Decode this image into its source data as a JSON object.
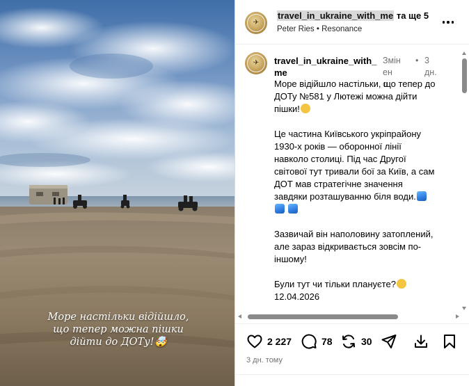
{
  "media": {
    "caption_lines": [
      "Море настільки відійшло,",
      "що тепер можна пішки",
      "дійти до ДОТу!🤯"
    ]
  },
  "header": {
    "username": "travel_in_ukraine_with_me",
    "and_more": "та ще 5",
    "audio_artist": "Peter Ries",
    "audio_separator": "•",
    "audio_title": "Resonance",
    "more_icon": "more-horizontal-icon"
  },
  "comment": {
    "username_line1": "travel_in_ukraine_with_",
    "username_line2": "me",
    "edited_line1": "Змінен",
    "edited_line2": "о",
    "dot": "•",
    "time_line1": "3",
    "time_line2": "дн.",
    "paragraphs": [
      {
        "lines": [
          "Море відійшло настільки, що тепер до",
          "ДОТу №581 у Лютежі можна дійти",
          "пішки!"
        ]
      },
      {
        "lines": [
          "Це частина Київського укріпрайону",
          "1930-х років — оборонної лінії",
          "навколо столиці. Під час Другої",
          "світової тут тривали бої за Київ, а сам",
          "ДОТ мав стратегічне значення",
          "завдяки розташуванню біля води."
        ]
      },
      {
        "lines": [
          "Зазвичай він наполовину затоплений,",
          "але зараз відкривається зовсім по-",
          "іншому!"
        ]
      },
      {
        "lines": [
          "Були тут чи тільки плануєте?",
          "12.04.2026"
        ]
      }
    ]
  },
  "actions": {
    "likes": "2 227",
    "comments": "78",
    "reposts": "30",
    "icons": [
      "heart-icon",
      "comment-icon",
      "repost-icon",
      "send-icon",
      "download-icon",
      "bookmark-icon"
    ]
  },
  "post_date": "3 дн. тому",
  "colors": {
    "text": "#000000",
    "muted": "#737373",
    "border": "#dbdbdb",
    "scrollbar": "#8a8a8a"
  }
}
